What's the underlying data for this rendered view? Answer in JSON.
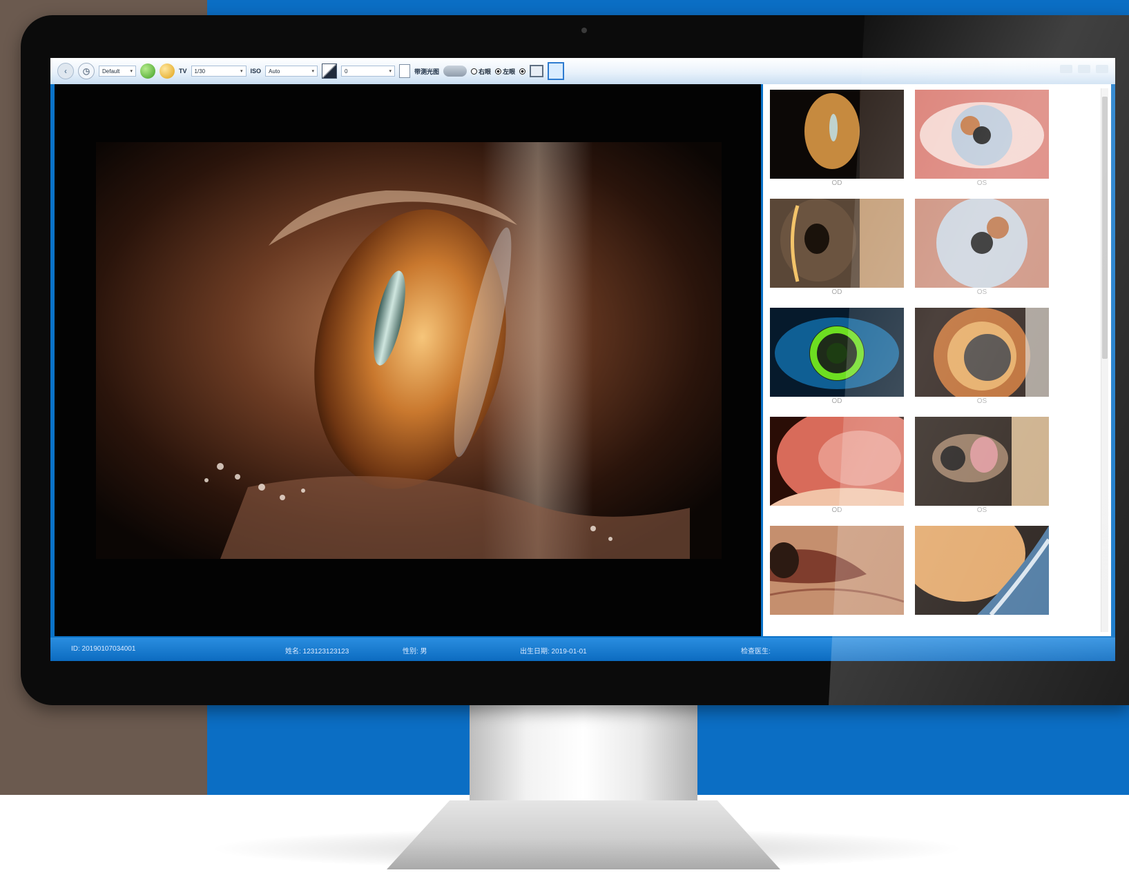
{
  "toolbar": {
    "profile_value": "Default",
    "tv_label": "TV",
    "tv_value": "1/30",
    "iso_label": "ISO",
    "iso_value": "Auto",
    "exposure_value": "0",
    "capture_label": "带测光图",
    "right_eye_label": "右眼",
    "left_eye_label": "左眼"
  },
  "thumbnails": [
    {
      "caption": "OD"
    },
    {
      "caption": "OS"
    },
    {
      "caption": "OD"
    },
    {
      "caption": "OS"
    },
    {
      "caption": "OD"
    },
    {
      "caption": "OS"
    },
    {
      "caption": "OD"
    },
    {
      "caption": "OS"
    },
    {
      "caption": ""
    },
    {
      "caption": ""
    }
  ],
  "status": {
    "id": "ID: 20190107034001",
    "name": "姓名: 123123123123",
    "gender": "性别: 男",
    "birth": "出生日期: 2019-01-01",
    "doctor": "检查医生:"
  },
  "icons": [
    "back-icon",
    "profile-icon",
    "capture-green-icon",
    "capture-yellow-icon",
    "exposure-icon",
    "page-icon",
    "toggle-icon",
    "monitor-icon",
    "split-pane-icon"
  ],
  "colors": {
    "background_blue": "#0b6ec4",
    "background_left": "#6b5a4f",
    "status_bar": "#1478cc"
  }
}
